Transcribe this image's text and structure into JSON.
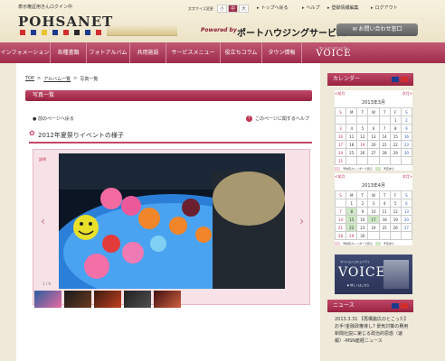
{
  "header": {
    "resident_label": "表示権証用きんロクイン中",
    "logo": "POHSANET",
    "font_size_label": "文字サイズ変更",
    "font_sizes": [
      "小",
      "中",
      "大"
    ],
    "links": [
      "トップへ戻る",
      "ヘルプ",
      "登録情報編集",
      "ログアウト"
    ],
    "powered_by": "Powered by",
    "brand": "ポートハウジングサービス",
    "inquiry": "お問い合わせ窓口"
  },
  "nav": {
    "items": [
      "インフォメーション",
      "各種書類",
      "フォトアルバム",
      "共用施設",
      "サービスメニュー",
      "役立ちコラム",
      "タウン情報"
    ],
    "voice_small": "マンションコミュニティ",
    "voice_big": "VOICE"
  },
  "breadcrumb": {
    "items": [
      "TOP",
      "アルバム一覧",
      "写真一覧"
    ],
    "separator": ">"
  },
  "page": {
    "title": "写真一覧",
    "prev_link": "前のページへ戻る",
    "help_link": "このページに関するヘルプ",
    "event_title": "2012年夏祭りイベントの様子"
  },
  "gallery": {
    "desc_label": "説明",
    "counter": "1 / 9"
  },
  "sidebar": {
    "calendar_title": "カレンダー",
    "prev": "<前月",
    "next": "次月>",
    "weekdays": [
      "S",
      "M",
      "T",
      "W",
      "T",
      "F",
      "S"
    ],
    "march": {
      "title": "2013年3月",
      "weeks": [
        [
          "",
          "",
          "",
          "",
          "",
          "1",
          "2"
        ],
        [
          "3",
          "4",
          "5",
          "6",
          "7",
          "8",
          "9"
        ],
        [
          "10",
          "11",
          "12",
          "13",
          "14",
          "15",
          "16"
        ],
        [
          "17",
          "18",
          "19",
          "20",
          "21",
          "22",
          "23"
        ],
        [
          "24",
          "25",
          "26",
          "27",
          "28",
          "29",
          "30"
        ],
        [
          "31",
          "",
          "",
          "",
          "",
          "",
          ""
        ]
      ]
    },
    "april": {
      "title": "2013年4月",
      "weeks": [
        [
          "",
          "1",
          "2",
          "3",
          "4",
          "5",
          "6"
        ],
        [
          "7",
          "8",
          "9",
          "10",
          "11",
          "12",
          "13"
        ],
        [
          "14",
          "15",
          "16",
          "17",
          "18",
          "19",
          "20"
        ],
        [
          "21",
          "22",
          "23",
          "24",
          "25",
          "26",
          "27"
        ],
        [
          "28",
          "29",
          "30",
          "",
          "",
          "",
          ""
        ]
      ]
    },
    "legend": [
      "予約有カレンダーで見る",
      "予定あり"
    ],
    "voice_small": "マンションコミュニティ",
    "voice_big": "VOICE",
    "voice_caption": "▶ 詳しくはこちら",
    "news_title": "ニュース",
    "news_text": "2013.3.31 【再構築広のとこった】お手!金融政権導し? 景気対策の費用新聞社説に第じる政治的思惑（速報）-MSN産経ニュース"
  },
  "colors": {
    "brand": "#9e2c4a",
    "calendar_event": "#cde8c4"
  }
}
